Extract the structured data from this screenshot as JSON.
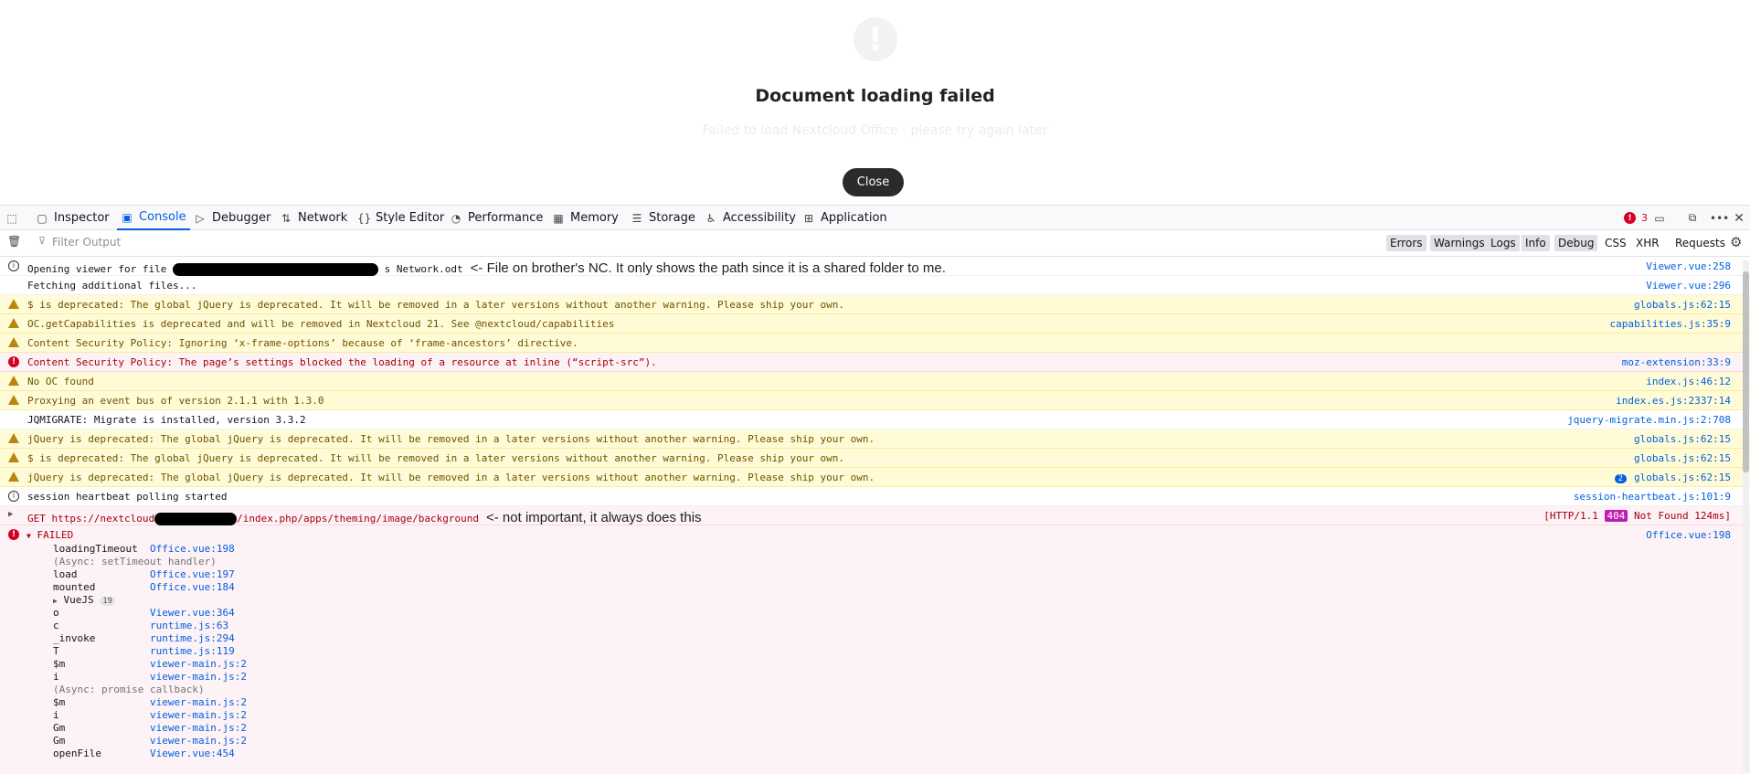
{
  "dialog": {
    "title": "Document loading failed",
    "subtitle": "Failed to load Nextcloud Office - please try again later",
    "close_label": "Close",
    "icon": "exclamation-icon"
  },
  "toolbar": {
    "tabs": [
      "Inspector",
      "Console",
      "Debugger",
      "Network",
      "Style Editor",
      "Performance",
      "Memory",
      "Storage",
      "Accessibility",
      "Application"
    ],
    "active_tab": "Console",
    "error_count": "3"
  },
  "filter": {
    "placeholder": "Filter Output",
    "levels": [
      "Errors",
      "Warnings",
      "Logs",
      "Info",
      "Debug"
    ],
    "types": [
      "CSS",
      "XHR",
      "Requests"
    ]
  },
  "messages": [
    {
      "level": "info",
      "text_a": "Opening viewer for file",
      "text_b": "s Network.odt",
      "annotation": "<- File on brother's NC. It only shows the path since it is a shared folder to me.",
      "location": "Viewer.vue:258"
    },
    {
      "level": "log",
      "text": "Fetching additional files...",
      "location": "Viewer.vue:296"
    },
    {
      "level": "warn",
      "text": "$ is deprecated: The global jQuery is deprecated. It will be removed in a later versions without another warning. Please ship your own.",
      "location": "globals.js:62:15"
    },
    {
      "level": "warn",
      "text": "OC.getCapabilities is deprecated and will be removed in Nextcloud 21. See @nextcloud/capabilities",
      "location": "capabilities.js:35:9"
    },
    {
      "level": "warn",
      "text": "Content Security Policy: Ignoring ‘x-frame-options’ because of ‘frame-ancestors’ directive.",
      "location": ""
    },
    {
      "level": "error",
      "text": "Content Security Policy: The page’s settings blocked the loading of a resource at inline (“script-src”).",
      "location": "moz-extension:33:9"
    },
    {
      "level": "warn",
      "text": "No OC found",
      "location": "index.js:46:12"
    },
    {
      "level": "warn",
      "text": "Proxying an event bus of version 2.1.1 with 1.3.0",
      "location": "index.es.js:2337:14"
    },
    {
      "level": "log",
      "text": "JQMIGRATE: Migrate is installed, version 3.3.2",
      "location": "jquery-migrate.min.js:2:708"
    },
    {
      "level": "warn",
      "text": "jQuery is deprecated: The global jQuery is deprecated. It will be removed in a later versions without another warning. Please ship your own.",
      "location": "globals.js:62:15"
    },
    {
      "level": "warn",
      "text": "$ is deprecated: The global jQuery is deprecated. It will be removed in a later versions without another warning. Please ship your own.",
      "location": "globals.js:62:15"
    },
    {
      "level": "warn",
      "text": "jQuery is deprecated: The global jQuery is deprecated. It will be removed in a later versions without another warning. Please ship your own.",
      "location": "globals.js:62:15",
      "repeat": "2"
    },
    {
      "level": "info",
      "text": "session heartbeat polling started",
      "location": "session-heartbeat.js:101:9"
    }
  ],
  "network_row": {
    "method": "GET",
    "url_a": "https://nextcloud",
    "url_b": "/index.php/apps/theming/image/background",
    "annotation": "<- not important, it always does this",
    "status_a": "[HTTP/1.1",
    "status_code": "404",
    "status_b": "Not Found 124ms]"
  },
  "failed": {
    "label": "FAILED",
    "location": "Office.vue:198",
    "stack": [
      {
        "fn": "loadingTimeout",
        "loc": "Office.vue:198"
      },
      {
        "async": "(Async: setTimeout handler)"
      },
      {
        "fn": "load",
        "loc": "Office.vue:197"
      },
      {
        "fn": "mounted",
        "loc": "Office.vue:184"
      },
      {
        "group": "VueJS",
        "count": "19"
      },
      {
        "fn": "o",
        "loc": "Viewer.vue:364"
      },
      {
        "fn": "c",
        "loc": "runtime.js:63"
      },
      {
        "fn": "_invoke",
        "loc": "runtime.js:294"
      },
      {
        "fn": "T",
        "loc": "runtime.js:119"
      },
      {
        "fn": "$m",
        "loc": "viewer-main.js:2"
      },
      {
        "fn": "i",
        "loc": "viewer-main.js:2"
      },
      {
        "async": "(Async: promise callback)"
      },
      {
        "fn": "$m",
        "loc": "viewer-main.js:2"
      },
      {
        "fn": "i",
        "loc": "viewer-main.js:2"
      },
      {
        "fn": "Gm",
        "loc": "viewer-main.js:2"
      },
      {
        "fn": "Gm",
        "loc": "viewer-main.js:2"
      },
      {
        "fn": "openFile",
        "loc": "Viewer.vue:454"
      }
    ]
  }
}
